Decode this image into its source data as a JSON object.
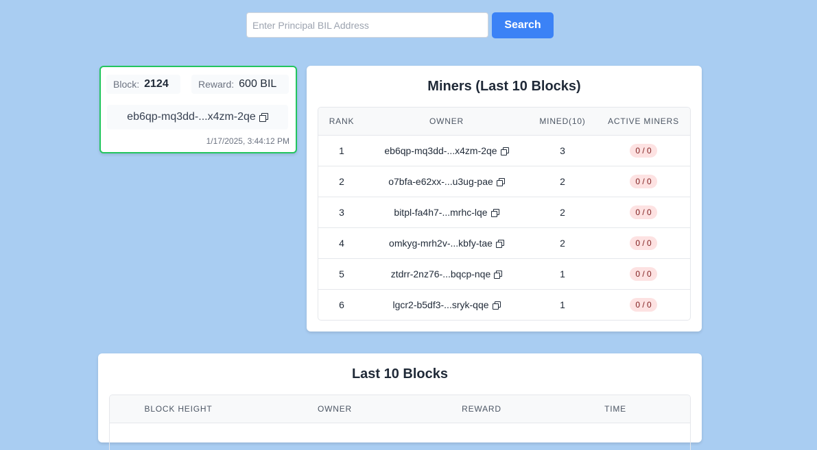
{
  "search": {
    "placeholder": "Enter Principal BIL Address",
    "value": "",
    "button_label": "Search"
  },
  "latest_block": {
    "block_label": "Block:",
    "block_value": "2124",
    "reward_label": "Reward:",
    "reward_value": "600 BIL",
    "owner": "eb6qp-mq3dd-...x4zm-2qe",
    "time": "1/17/2025, 3:44:12 PM"
  },
  "miners": {
    "title": "Miners (Last 10 Blocks)",
    "columns": [
      "RANK",
      "OWNER",
      "MINED(10)",
      "ACTIVE MINERS"
    ],
    "rows": [
      {
        "rank": "1",
        "owner": "eb6qp-mq3dd-...x4zm-2qe",
        "mined": "3",
        "active": "0 / 0"
      },
      {
        "rank": "2",
        "owner": "o7bfa-e62xx-...u3ug-pae",
        "mined": "2",
        "active": "0 / 0"
      },
      {
        "rank": "3",
        "owner": "bitpl-fa4h7-...mrhc-lqe",
        "mined": "2",
        "active": "0 / 0"
      },
      {
        "rank": "4",
        "owner": "omkyg-mrh2v-...kbfy-tae",
        "mined": "2",
        "active": "0 / 0"
      },
      {
        "rank": "5",
        "owner": "ztdrr-2nz76-...bqcp-nqe",
        "mined": "1",
        "active": "0 / 0"
      },
      {
        "rank": "6",
        "owner": "lgcr2-b5df3-...sryk-qqe",
        "mined": "1",
        "active": "0 / 0"
      }
    ]
  },
  "blocks": {
    "title": "Last 10 Blocks",
    "columns": [
      "BLOCK HEIGHT",
      "OWNER",
      "REWARD",
      "TIME"
    ]
  },
  "icons": {
    "copy": "copy-icon"
  },
  "colors": {
    "background": "#a9cdf2",
    "accent": "#3b82f6",
    "card_border": "#22c55e",
    "badge_bg": "#fde2e2"
  }
}
